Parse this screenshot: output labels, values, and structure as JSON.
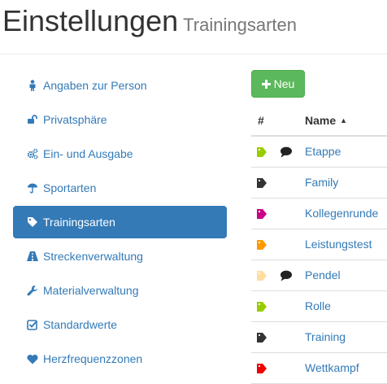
{
  "header": {
    "title": "Einstellungen",
    "subtitle": "Trainingsarten"
  },
  "sidebar": {
    "items": [
      {
        "label": "Angaben zur Person",
        "icon": "user-icon"
      },
      {
        "label": "Privatsphäre",
        "icon": "unlock-icon"
      },
      {
        "label": "Ein- und Ausgabe",
        "icon": "cogs-icon"
      },
      {
        "label": "Sportarten",
        "icon": "umbrella-icon"
      },
      {
        "label": "Trainingsarten",
        "icon": "tag-icon",
        "active": true
      },
      {
        "label": "Streckenverwaltung",
        "icon": "road-icon"
      },
      {
        "label": "Materialverwaltung",
        "icon": "wrench-icon"
      },
      {
        "label": "Standardwerte",
        "icon": "check-square-icon"
      },
      {
        "label": "Herzfrequenzzonen",
        "icon": "heart-icon"
      }
    ]
  },
  "toolbar": {
    "new_label": "Neu",
    "new_button_color": "#5cb85c"
  },
  "table": {
    "col_hash": "#",
    "col_name": "Name",
    "sort": "ascending",
    "rows": [
      {
        "name": "Etappe",
        "tag_color": "#99cc00",
        "has_comment": true
      },
      {
        "name": "Family",
        "tag_color": "#333333",
        "has_comment": false
      },
      {
        "name": "Kollegenrunde",
        "tag_color": "#cc0088",
        "has_comment": false
      },
      {
        "name": "Leistungstest",
        "tag_color": "#ff9900",
        "has_comment": false
      },
      {
        "name": "Pendel",
        "tag_color": "#ffdda0",
        "has_comment": true
      },
      {
        "name": "Rolle",
        "tag_color": "#99cc00",
        "has_comment": false
      },
      {
        "name": "Training",
        "tag_color": "#333333",
        "has_comment": false
      },
      {
        "name": "Wettkampf",
        "tag_color": "#ee0000",
        "has_comment": false
      }
    ]
  },
  "colors": {
    "link": "#337ab7",
    "active_bg": "#337ab7"
  }
}
